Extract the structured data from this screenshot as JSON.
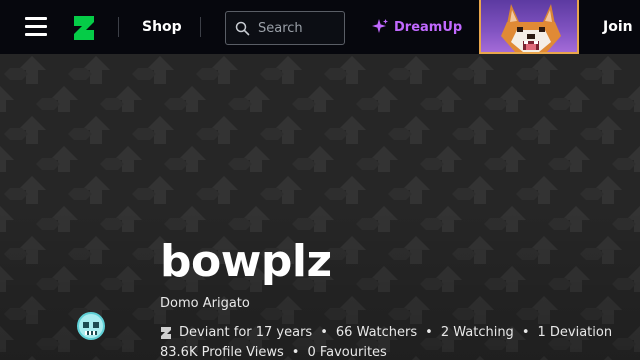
{
  "header": {
    "nav_items": {
      "shop": "Shop",
      "join": "Join"
    },
    "search": {
      "placeholder": "Search"
    },
    "dreamup": {
      "label": "DreamUp",
      "color": "#c169ff"
    },
    "brand_color": "#05cc47"
  },
  "profile": {
    "username": "bowplz",
    "tagline": "Domo Arigato",
    "stats": {
      "deviant_for": "Deviant for 17 years",
      "watchers": "66 Watchers",
      "watching": "2 Watching",
      "deviations": "1 Deviation",
      "profile_views": "83.6K Profile Views",
      "favourites": "0 Favourites"
    },
    "separator": "•"
  }
}
